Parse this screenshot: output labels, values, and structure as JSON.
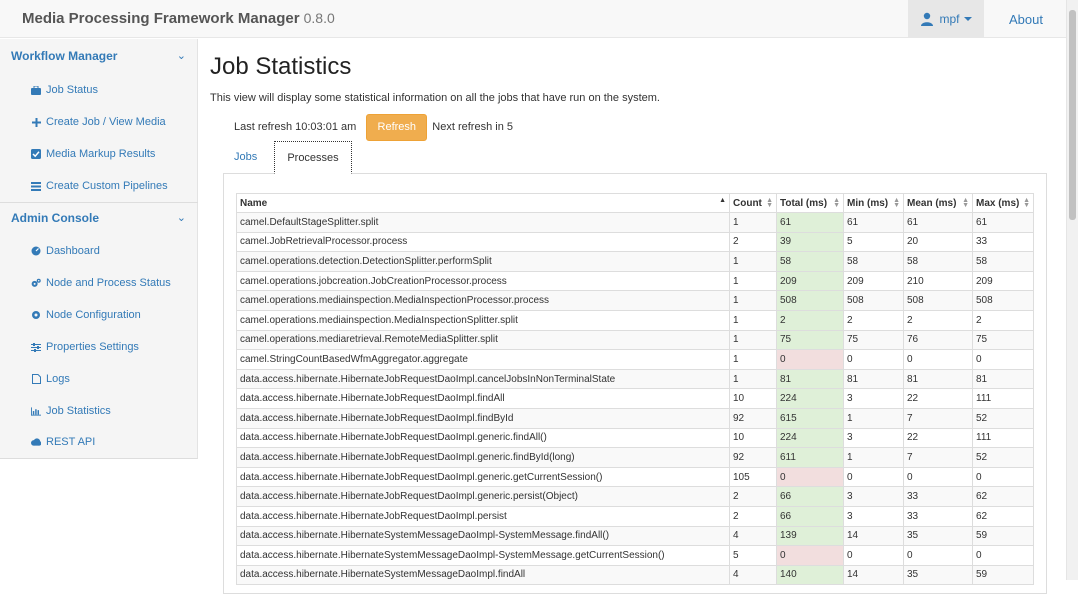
{
  "navbar": {
    "brand": "Media Processing Framework Manager",
    "version": "0.8.0",
    "user": "mpf",
    "about": "About"
  },
  "sidebar": {
    "workflow_title": "Workflow Manager",
    "workflow_items": [
      {
        "label": "Job Status",
        "icon": "briefcase-icon"
      },
      {
        "label": "Create Job / View Media",
        "icon": "plus-icon"
      },
      {
        "label": "Media Markup Results",
        "icon": "checkbox-icon"
      },
      {
        "label": "Create Custom Pipelines",
        "icon": "list-icon"
      }
    ],
    "admin_title": "Admin Console",
    "admin_items": [
      {
        "label": "Dashboard",
        "icon": "dashboard-icon"
      },
      {
        "label": "Node and Process Status",
        "icon": "cogs-icon"
      },
      {
        "label": "Node Configuration",
        "icon": "gear-icon"
      },
      {
        "label": "Properties Settings",
        "icon": "sliders-icon"
      },
      {
        "label": "Logs",
        "icon": "file-icon"
      },
      {
        "label": "Job Statistics",
        "icon": "bar-chart-icon"
      },
      {
        "label": "REST API",
        "icon": "cloud-icon"
      }
    ]
  },
  "main": {
    "title": "Job Statistics",
    "description": "This view will display some statistical information on all the jobs that have run on the system.",
    "last_refresh": "Last refresh 10:03:01 am",
    "refresh_button": "Refresh",
    "next_refresh": "Next refresh in 5",
    "tabs": [
      "Jobs",
      "Processes"
    ],
    "active_tab": "Processes"
  },
  "colors": {
    "link": "#337ab7",
    "refresh_button": "#f0ad4e",
    "total_positive": "#dff0d8",
    "total_zero": "#f2dede"
  },
  "table": {
    "columns": [
      "Name",
      "Count",
      "Total (ms)",
      "Min (ms)",
      "Mean (ms)",
      "Max (ms)"
    ],
    "sorted_column": "Name",
    "rows": [
      [
        "camel.DefaultStageSplitter.split",
        "1",
        "61",
        "61",
        "61",
        "61"
      ],
      [
        "camel.JobRetrievalProcessor.process",
        "2",
        "39",
        "5",
        "20",
        "33"
      ],
      [
        "camel.operations.detection.DetectionSplitter.performSplit",
        "1",
        "58",
        "58",
        "58",
        "58"
      ],
      [
        "camel.operations.jobcreation.JobCreationProcessor.process",
        "1",
        "209",
        "209",
        "210",
        "209"
      ],
      [
        "camel.operations.mediainspection.MediaInspectionProcessor.process",
        "1",
        "508",
        "508",
        "508",
        "508"
      ],
      [
        "camel.operations.mediainspection.MediaInspectionSplitter.split",
        "1",
        "2",
        "2",
        "2",
        "2"
      ],
      [
        "camel.operations.mediaretrieval.RemoteMediaSplitter.split",
        "1",
        "75",
        "75",
        "76",
        "75"
      ],
      [
        "camel.StringCountBasedWfmAggregator.aggregate",
        "1",
        "0",
        "0",
        "0",
        "0"
      ],
      [
        "data.access.hibernate.HibernateJobRequestDaoImpl.cancelJobsInNonTerminalState",
        "1",
        "81",
        "81",
        "81",
        "81"
      ],
      [
        "data.access.hibernate.HibernateJobRequestDaoImpl.findAll",
        "10",
        "224",
        "3",
        "22",
        "111"
      ],
      [
        "data.access.hibernate.HibernateJobRequestDaoImpl.findById",
        "92",
        "615",
        "1",
        "7",
        "52"
      ],
      [
        "data.access.hibernate.HibernateJobRequestDaoImpl.generic.findAll()",
        "10",
        "224",
        "3",
        "22",
        "111"
      ],
      [
        "data.access.hibernate.HibernateJobRequestDaoImpl.generic.findById(long)",
        "92",
        "611",
        "1",
        "7",
        "52"
      ],
      [
        "data.access.hibernate.HibernateJobRequestDaoImpl.generic.getCurrentSession()",
        "105",
        "0",
        "0",
        "0",
        "0"
      ],
      [
        "data.access.hibernate.HibernateJobRequestDaoImpl.generic.persist(Object)",
        "2",
        "66",
        "3",
        "33",
        "62"
      ],
      [
        "data.access.hibernate.HibernateJobRequestDaoImpl.persist",
        "2",
        "66",
        "3",
        "33",
        "62"
      ],
      [
        "data.access.hibernate.HibernateSystemMessageDaoImpl-SystemMessage.findAll()",
        "4",
        "139",
        "14",
        "35",
        "59"
      ],
      [
        "data.access.hibernate.HibernateSystemMessageDaoImpl-SystemMessage.getCurrentSession()",
        "5",
        "0",
        "0",
        "0",
        "0"
      ],
      [
        "data.access.hibernate.HibernateSystemMessageDaoImpl.findAll",
        "4",
        "140",
        "14",
        "35",
        "59"
      ]
    ]
  }
}
